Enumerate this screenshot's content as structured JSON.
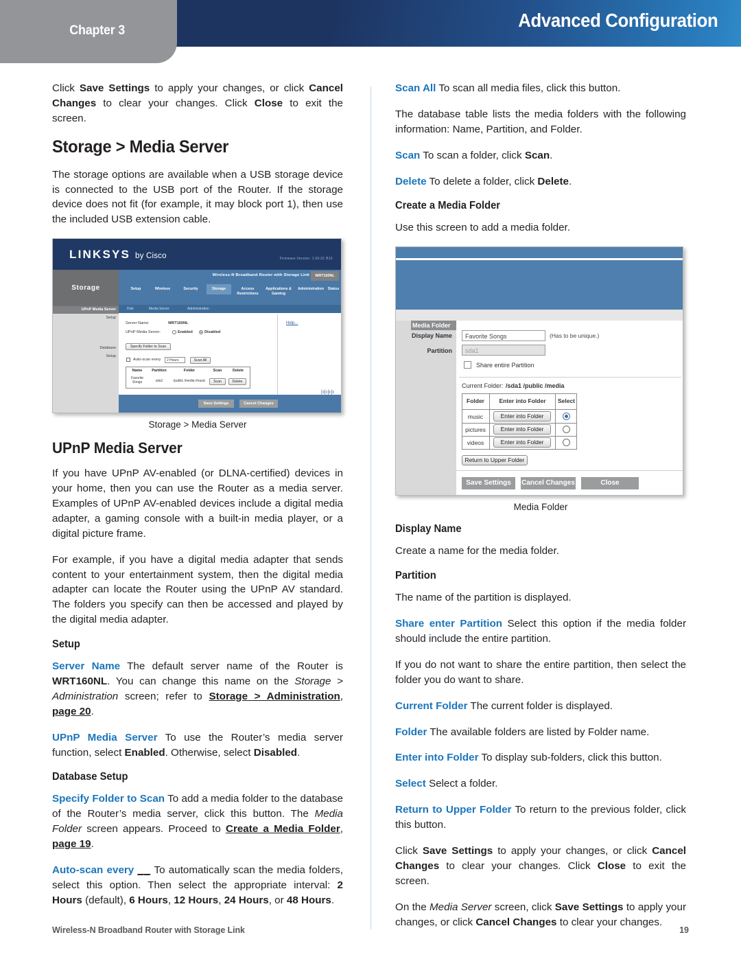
{
  "header": {
    "chapter": "Chapter 3",
    "title": "Advanced Configuration"
  },
  "colors": {
    "accent_keyword": "#1b75bb",
    "header_navy": "#1d3461",
    "header_light_blue": "#2f8bc9",
    "chapter_tab_gray": "#939598",
    "divider": "#bfd8e0",
    "footer_text": "#58595b"
  },
  "left_column": {
    "intro_paragraph": {
      "p1": "Click ",
      "b1": "Save Settings",
      "p2": " to apply your changes, or click ",
      "b2": "Cancel Changes",
      "p3": " to clear your changes. Click ",
      "b3": "Close",
      "p4": " to exit the screen."
    },
    "heading_storage_media_server": "Storage > Media Server",
    "storage_paragraph": "The storage options are available when a USB storage device is connected to the USB port of the Router. If the storage device does not fit (for example, it may block port 1), then use the included USB extension cable.",
    "figure1_caption": "Storage > Media Server",
    "heading_upnp_media_server": "UPnP Media Server",
    "upnp_paragraph_1": "If you have UPnP AV-enabled (or DLNA-certified) devices in your home, then you can use the Router as a media server. Examples of UPnP AV-enabled devices include a digital media adapter, a gaming console with a built-in media player, or a digital picture frame.",
    "upnp_paragraph_2": "For example, if you have a digital media adapter that sends content to your entertainment system, then the digital media adapter can locate the Router using the UPnP AV standard. The folders you specify can then be accessed and played by the digital media adapter.",
    "heading_setup": "Setup",
    "server_name": {
      "kw": "Server Name",
      "t1": " The default server name of the Router is ",
      "b1": "WRT160NL",
      "t2": ". You can change this name on the ",
      "i1": "Storage > Administration",
      "t3": " screen; refer to ",
      "u1": "Storage > Administration",
      "t4": ", ",
      "u2": "page 20",
      "t5": "."
    },
    "upnp_media_server_item": {
      "kw": "UPnP Media Server",
      "t1": " To use the Router’s media server function, select ",
      "b1": "Enabled",
      "t2": ". Otherwise, select ",
      "b2": "Disabled",
      "t3": "."
    },
    "heading_database_setup": "Database Setup",
    "specify_folder": {
      "kw": "Specify Folder to Scan",
      "t1": " To add a media folder to the database of the Router’s media server, click this button. The ",
      "i1": "Media Folder",
      "t2": " screen appears. Proceed to ",
      "u1": "Create a Media Folder",
      "t3": ", ",
      "u2": "page 19",
      "t4": "."
    },
    "auto_scan": {
      "kw": "Auto-scan every",
      "blank": "__",
      "t1": " To automatically scan the media folders, select this option. Then select the appropriate interval: ",
      "b1": "2 Hours",
      "t2": " (default), ",
      "b2": "6 Hours",
      "t3": ", ",
      "b3": "12 Hours",
      "t4": ", ",
      "b4": "24 Hours",
      "t5": ", or ",
      "b5": "48 Hours",
      "t6": "."
    }
  },
  "right_column": {
    "scan_all": {
      "kw": "Scan All",
      "t1": "  To scan all media files, click this button."
    },
    "database_table_paragraph": "The database table lists the media folders with the following information: Name, Partition, and Folder.",
    "scan": {
      "kw": "Scan",
      "t1": "  To scan a folder, click ",
      "b1": "Scan",
      "t2": "."
    },
    "delete": {
      "kw": "Delete",
      "t1": "  To delete a folder, click ",
      "b1": "Delete",
      "t2": "."
    },
    "heading_create_media_folder": "Create a Media Folder",
    "use_this_screen": "Use this screen to add a media folder.",
    "figure2_caption": "Media Folder",
    "heading_display_name": "Display Name",
    "display_name_text": "Create a name for the media folder.",
    "heading_partition": "Partition",
    "partition_text": "The name of the partition is displayed.",
    "share_entire_partition": {
      "kw": "Share enter Partition",
      "t1": " Select this option if the media folder should include the entire partition."
    },
    "if_you_do_not_want": "If you do not want to share the entire partition, then select the folder you do want to share.",
    "current_folder": {
      "kw": "Current Folder",
      "t1": "  The current folder is displayed."
    },
    "folder": {
      "kw": "Folder",
      "t1": "  The available folders are listed by Folder name."
    },
    "enter_into_folder": {
      "kw": "Enter into Folder",
      "t1": " To display sub-folders, click this button."
    },
    "select": {
      "kw": "Select",
      "t1": "  Select a folder."
    },
    "return_to_upper_folder": {
      "kw": "Return to Upper Folder",
      "t1": "  To return to the previous folder, click this button."
    },
    "click_save_settings": {
      "p1": "Click ",
      "b1": "Save Settings",
      "p2": " to apply your changes, or click ",
      "b2": "Cancel Changes",
      "p3": " to clear your changes. Click ",
      "b3": "Close",
      "p4": " to exit the screen."
    },
    "on_media_server": {
      "t1": "On the ",
      "i1": "Media Server",
      "t2": " screen, click ",
      "b1": "Save Settings",
      "t3": " to apply your changes, or click ",
      "b2": "Cancel Changes",
      "t4": " to clear your changes."
    }
  },
  "figure1_screenshot": {
    "brand": "LINKSYS",
    "brand_sub": "by Cisco",
    "firmware": "Firmware Version: 1.00.01 B15",
    "section_title": "Storage",
    "product_name": "Wireless-N Broadband Router with Storage Link",
    "model": "WRT160NL",
    "tabs": [
      "Setup",
      "Wireless",
      "Security",
      "Storage",
      "Access Restrictions",
      "Applications & Gaming",
      "Administration",
      "Status"
    ],
    "active_tab": "Storage",
    "subtabs": [
      "Disk",
      "Media Server",
      "Administration"
    ],
    "sidenav": [
      "UPnP Media Server",
      "Setup",
      "Database",
      "Setup"
    ],
    "fields": {
      "server_name_label": "Server Name:",
      "server_name_value": "WRT160NL",
      "upnp_label": "UPnP Media Server:",
      "radio_enabled": "Enabled",
      "radio_disabled": "Disabled",
      "specify_button": "Specify Folder to Scan",
      "autoscan_label": "Auto-scan every",
      "autoscan_value": "2 Hours",
      "scan_all_button": "Scan All"
    },
    "table": {
      "headers": [
        "Name",
        "Partition",
        "Folder",
        "Scan",
        "Delete"
      ],
      "row": [
        "Favorite Songs",
        "sda1",
        "/public /media /music",
        "Scan",
        "Delete"
      ]
    },
    "help_link": "Help...",
    "footer_buttons": [
      "Save Settings",
      "Cancel Changes"
    ],
    "cisco_logo": "CISCO."
  },
  "figure2_screenshot": {
    "tab_label": "Media Folder",
    "display_name_label": "Display Name",
    "display_name_value": "Favorite Songs",
    "display_name_hint": "(Has to be unique.)",
    "partition_label": "Partition",
    "partition_value": "sda1",
    "share_checkbox_label": "Share entire Partition",
    "current_folder_label": "Current Folder:",
    "current_folder_path": "/sda1 /public /media",
    "table_headers": [
      "Folder",
      "Enter into Folder",
      "Select"
    ],
    "rows": [
      {
        "folder": "music",
        "button": "Enter into Folder",
        "selected": true
      },
      {
        "folder": "pictures",
        "button": "Enter into Folder",
        "selected": false
      },
      {
        "folder": "videos",
        "button": "Enter into Folder",
        "selected": false
      }
    ],
    "return_button": "Return to Upper Folder",
    "footer_buttons": [
      "Save Settings",
      "Cancel Changes",
      "Close"
    ]
  },
  "footer": {
    "left": "Wireless-N Broadband Router with Storage Link",
    "page_number": "19"
  }
}
